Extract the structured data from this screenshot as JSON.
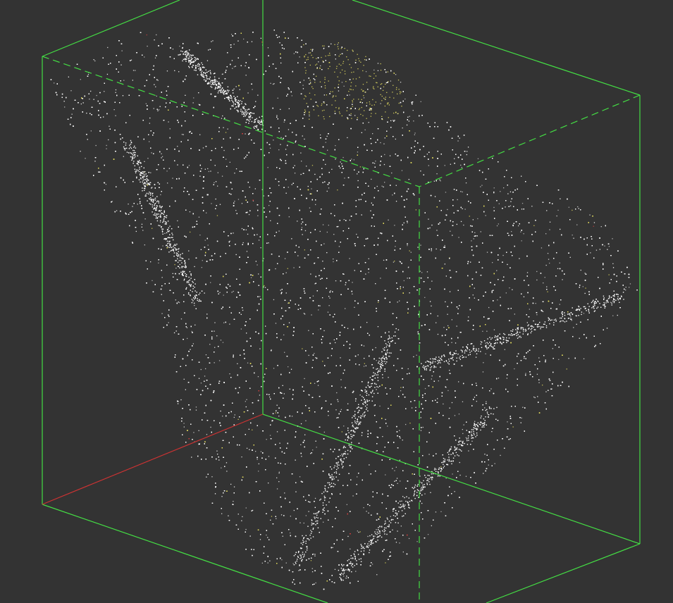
{
  "viewer": {
    "type": "point-cloud-viewport",
    "background_color": "#333333",
    "frame_color": "#000000",
    "bounding_box_color": "#44dd44",
    "axis_x_color": "#cc3333",
    "point_color_primary": "#ffffff",
    "point_color_secondary": "#e8e060",
    "point_color_accent": "#d04040",
    "bounding_box_style": "solid-front / dashed-hidden",
    "text_labels": []
  }
}
